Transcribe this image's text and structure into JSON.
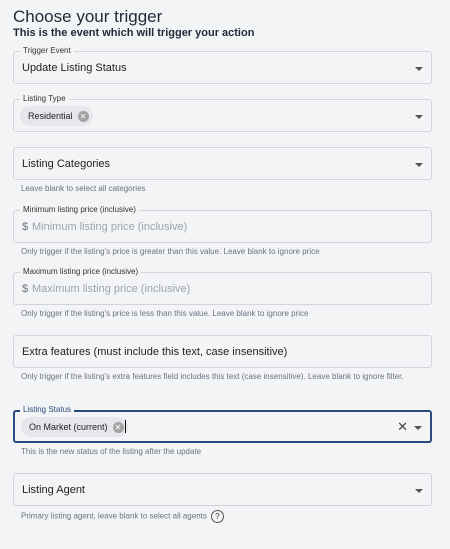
{
  "header": {
    "title": "Choose your trigger",
    "subtitle": "This is the event which will trigger your action"
  },
  "trigger_event": {
    "label": "Trigger Event",
    "value": "Update Listing Status"
  },
  "listing_type": {
    "label": "Listing Type",
    "chip": "Residential"
  },
  "listing_categories": {
    "value": "Listing Categories",
    "help": "Leave blank to select all categories"
  },
  "min_price": {
    "label": "Minimum listing price (inclusive)",
    "currency": "$",
    "placeholder": "Minimum listing price (inclusive)",
    "help": "Only trigger if the listing's price is greater than this value. Leave blank to ignore price"
  },
  "max_price": {
    "label": "Maximum listing price (inclusive)",
    "currency": "$",
    "placeholder": "Maximum listing price (inclusive)",
    "help": "Only trigger if the listing's price is less than this value. Leave blank to ignore price"
  },
  "extra_features": {
    "value": "Extra features (must include this text, case insensitive)",
    "help": "Only trigger if the listing's extra features field includes this text (case insensitive). Leave blank to ignore filter."
  },
  "listing_status": {
    "label": "Listing Status",
    "chip": "On Market (current)",
    "help": "This is the new status of the listing after the update"
  },
  "listing_agent": {
    "value": "Listing Agent",
    "help": "Primary listing agent, leave blank to select all agents"
  },
  "icons": {
    "chip_remove": "x-circle-icon",
    "dropdown": "caret-down-icon",
    "clear": "close-icon",
    "help": "question-icon"
  },
  "colors": {
    "focus": "#2a4a7f",
    "background": "#f3f4f6"
  }
}
